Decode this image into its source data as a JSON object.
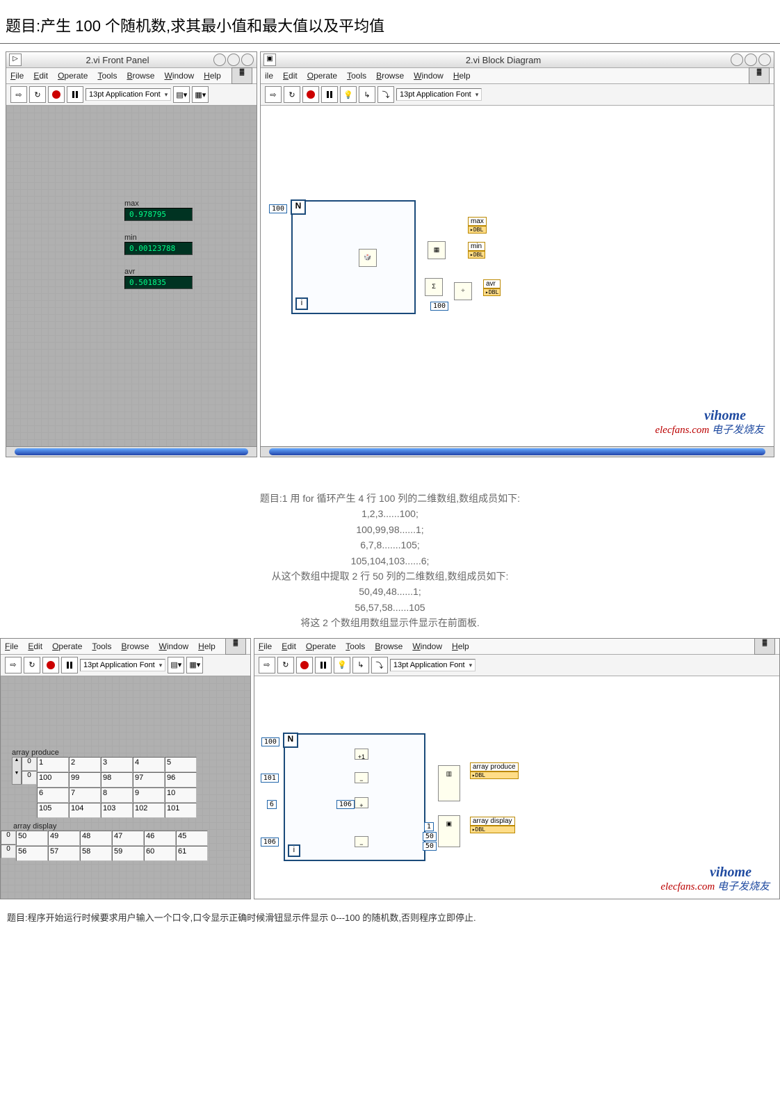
{
  "title1": "题目:产生 100 个随机数,求其最小值和最大值以及平均值",
  "example1": {
    "front_title": "2.vi Front Panel",
    "block_title": "2.vi Block Diagram",
    "menus_fp": [
      "File",
      "Edit",
      "Operate",
      "Tools",
      "Browse",
      "Window",
      "Help"
    ],
    "menus_bd": [
      "ile",
      "Edit",
      "Operate",
      "Tools",
      "Browse",
      "Window",
      "Help"
    ],
    "font": "13pt Application Font",
    "fields": {
      "max": {
        "label": "max",
        "value": "0.978795"
      },
      "min": {
        "label": "min",
        "value": "0.00123788"
      },
      "avr": {
        "label": "avr",
        "value": "0.501835"
      }
    },
    "bd": {
      "loop_n": "100",
      "inds": [
        "max",
        "min",
        "avr"
      ],
      "i_const": "100"
    }
  },
  "section2_text": [
    "题目:1 用 for 循环产生 4 行 100 列的二维数组,数组成员如下:",
    "1,2,3......100;",
    "100,99,98......1;",
    "6,7,8.......105;",
    "105,104,103......6;",
    "从这个数组中提取 2 行 50 列的二维数组,数组成员如下:",
    "50,49,48......1;",
    "56,57,58......105",
    "将这 2 个数组用数组显示件显示在前面板."
  ],
  "example2": {
    "menus_fp": [
      "File",
      "Edit",
      "Operate",
      "Tools",
      "Browse",
      "Window",
      "Help"
    ],
    "menus_bd": [
      "File",
      "Edit",
      "Operate",
      "Tools",
      "Browse",
      "Window",
      "Help"
    ],
    "font": "13pt Application Font",
    "front": {
      "arr1_label": "array produce",
      "arr1_idx": [
        "0",
        "0"
      ],
      "arr1": [
        [
          "1",
          "2",
          "3",
          "4",
          "5"
        ],
        [
          "100",
          "99",
          "98",
          "97",
          "96"
        ],
        [
          "6",
          "7",
          "8",
          "9",
          "10"
        ],
        [
          "105",
          "104",
          "103",
          "102",
          "101"
        ]
      ],
      "arr2_label": "array display",
      "arr2_idx": [
        "0",
        "0"
      ],
      "arr2": [
        [
          "50",
          "49",
          "48",
          "47",
          "46",
          "45"
        ],
        [
          "56",
          "57",
          "58",
          "59",
          "60",
          "61"
        ]
      ]
    },
    "bd": {
      "loop_n": "100",
      "consts": [
        "101",
        "1",
        "6",
        "106",
        "50",
        "50"
      ],
      "inds": [
        "array produce",
        "array display"
      ]
    }
  },
  "watermark": {
    "v": "vihome",
    "e": "elecfans.com",
    "cn": "电子发烧友"
  },
  "title3": "题目:程序开始运行时候要求用户输入一个口令,口令显示正确时候滑钮显示件显示 0---100 的随机数,否则程序立即停止."
}
